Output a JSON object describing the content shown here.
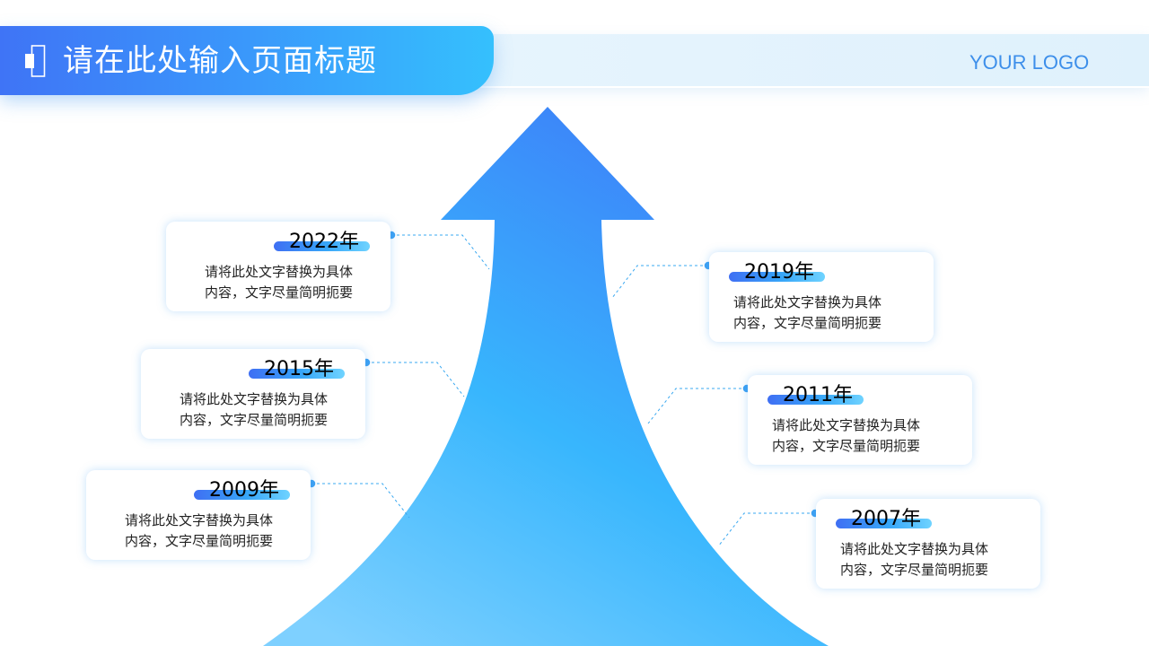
{
  "header": {
    "title": "请在此处输入页面标题",
    "logo": "YOUR LOGO"
  },
  "colors": {
    "primary": "#3f74f6",
    "accent": "#35c0fd",
    "logo": "#3d8fea",
    "connector": "#3aa8f0"
  },
  "milestones": [
    {
      "year": "2022年",
      "line1": "请将此处文字替换为具体",
      "line2": "内容，文字尽量简明扼要"
    },
    {
      "year": "2015年",
      "line1": "请将此处文字替换为具体",
      "line2": "内容，文字尽量简明扼要"
    },
    {
      "year": "2009年",
      "line1": "请将此处文字替换为具体",
      "line2": "内容，文字尽量简明扼要"
    },
    {
      "year": "2019年",
      "line1": "请将此处文字替换为具体",
      "line2": "内容，文字尽量简明扼要"
    },
    {
      "year": "2011年",
      "line1": "请将此处文字替换为具体",
      "line2": "内容，文字尽量简明扼要"
    },
    {
      "year": "2007年",
      "line1": "请将此处文字替换为具体",
      "line2": "内容，文字尽量简明扼要"
    }
  ]
}
